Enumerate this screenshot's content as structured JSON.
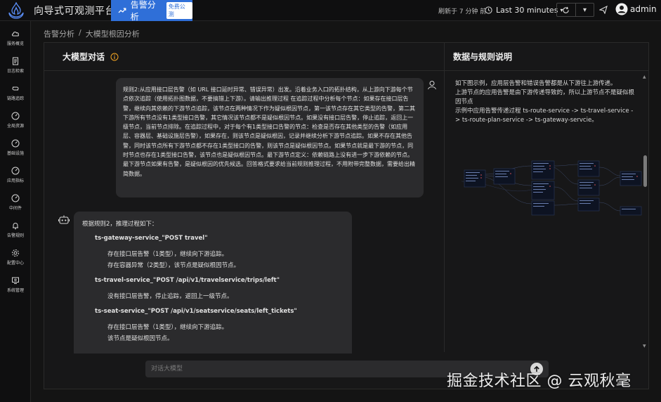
{
  "app": {
    "title": "向导式可观测平台"
  },
  "topbar": {
    "active_tab": {
      "label": "告警分析",
      "badge": "免费公测"
    },
    "refresh_text": "刷新于 7 分钟 前",
    "time_range": "Last 30 minutes",
    "user_name": "admin"
  },
  "sidebar": {
    "items": [
      {
        "label": "服务概览",
        "icon": "cloud-icon"
      },
      {
        "label": "日志检索",
        "icon": "doc-icon"
      },
      {
        "label": "链路追踪",
        "icon": "link-icon"
      },
      {
        "label": "全局资源",
        "icon": "gauge-icon"
      },
      {
        "label": "基础设施",
        "icon": "gauge-icon"
      },
      {
        "label": "应用指标",
        "icon": "gauge-icon"
      },
      {
        "label": "中间件",
        "icon": "gauge-icon"
      },
      {
        "label": "告警规则",
        "icon": "bell-icon"
      },
      {
        "label": "配置中心",
        "icon": "gear-icon"
      },
      {
        "label": "系统管理",
        "icon": "monitor-icon"
      }
    ]
  },
  "breadcrumb": {
    "parent": "告警分析",
    "separator": "/",
    "current": "大模型根因分析"
  },
  "chat": {
    "title": "大模型对话",
    "user_message": "规则2:从应用接口层告警（如 URL 接口延时异常、错误异常）出发。沿着业务入口的拓扑结构，从上游向下游每个节点依次追踪（使用拓扑图数据，不要搞错上下游）。请输出推理过程 在追踪过程中分析每个节点：如果存在接口层告警，继续向其依赖的下游节点追踪，该节点在两种情况下作为疑似根因节点，第一该节点存在其它类型的告警，第二其下游所有节点没有1类型接口告警，其它情况该节点都不是疑似根因节点。如果没有接口层告警，停止追踪，返回上一级节点，当前节点排除。在追踪过程中，对于每个有1类型接口告警的节点：检查是否存在其他类型的告警（如应用层、容器层、基础设施层告警），如果存在，则该节点是疑似根因，记录并继续分析下游节点追踪。如果不存在其他告警，同时该节点所有下游节点都不存在1类型接口的告警，则该节点是疑似根因节点。如果节点就是最下游的节点，同时节点也存在1类型接口告警，该节点也是疑似根因节点。最下游节点定义：依赖链路上没有进一步下游依赖的节点。最下游节点如果有告警，是疑似根因的优先候选。回答格式要求给当前规则推理过程，不用附带完整数据，需要给出精简数据。",
    "bot_intro": "根据规则2，推理过程如下：",
    "services": [
      {
        "name": "ts-gateway-service_\"POST travel\"",
        "lines": [
          "存在接口层告警（1类型），继续向下游追踪。",
          "存在容器异常（2类型），该节点是疑似根因节点。"
        ]
      },
      {
        "name": "ts-travel-service_\"POST /api/v1/travelservice/trips/left\"",
        "lines": [
          "没有接口层告警，停止追踪，返回上一级节点。"
        ]
      },
      {
        "name": "ts-seat-service_\"POST /api/v1/seatservice/seats/left_tickets\"",
        "lines": [
          "存在接口层告警（1类型），继续向下游追踪。",
          "该节点是疑似根因节点。"
        ]
      }
    ],
    "input_placeholder": "对话大模型"
  },
  "rules": {
    "title": "数据与规则说明",
    "paragraphs": [
      "如下图示例，应用层告警和错误告警都是从下游往上游传递。",
      "上游节点的应用告警是由下游传递导致的，所以上游节点不是疑似根因节点",
      "示例中应用告警传递过程 ts-route-service -> ts-travel-service -> ts-route-plan-service -> ts-gateway-servcie。"
    ]
  },
  "watermark": "掘金技术社区 @ 云观秋毫",
  "colors": {
    "accent": "#2f6fd8",
    "background": "#141414",
    "panel": "#171718",
    "bubble": "#2b2b2d",
    "warning": "#f5a623"
  }
}
